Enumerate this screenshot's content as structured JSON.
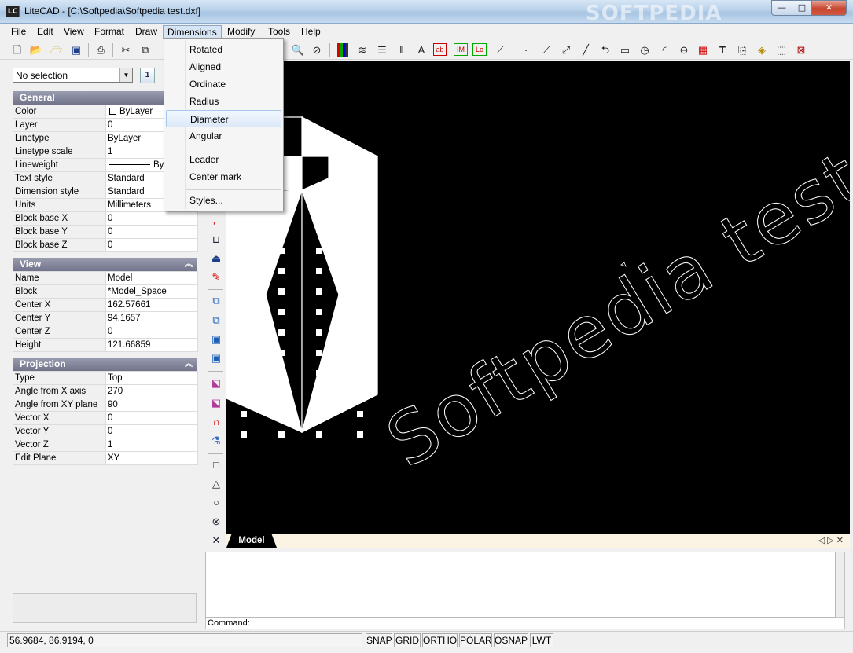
{
  "window": {
    "title": "LiteCAD - [C:\\Softpedia\\Softpedia test.dxf]",
    "watermark": "SOFTPEDIA",
    "controls": {
      "minimize": "—",
      "maximize": "□",
      "close": "✕"
    }
  },
  "menubar": [
    "File",
    "Edit",
    "View",
    "Format",
    "Draw",
    "Dimensions",
    "Modify",
    "Tools",
    "Help"
  ],
  "dimensions_menu": {
    "items": [
      "Rotated",
      "Aligned",
      "Ordinate",
      "Radius",
      "Diameter",
      "Angular",
      "Leader",
      "Center mark",
      "Styles..."
    ],
    "highlighted": "Diameter"
  },
  "left_panel": {
    "selection": "No selection",
    "selection_button": "1",
    "general": {
      "title": "General",
      "rows": [
        [
          "Color",
          "ByLayer"
        ],
        [
          "Layer",
          "0"
        ],
        [
          "Linetype",
          "ByLayer"
        ],
        [
          "Linetype scale",
          "1"
        ],
        [
          "Lineweight",
          "By"
        ],
        [
          "Text style",
          "Standard"
        ],
        [
          "Dimension style",
          "Standard"
        ],
        [
          "Units",
          "Millimeters"
        ],
        [
          "Block base X",
          "0"
        ],
        [
          "Block base Y",
          "0"
        ],
        [
          "Block base Z",
          "0"
        ]
      ]
    },
    "view": {
      "title": "View",
      "rows": [
        [
          "Name",
          "Model"
        ],
        [
          "Block",
          "*Model_Space"
        ],
        [
          "Center X",
          "162.57661"
        ],
        [
          "Center Y",
          "94.1657"
        ],
        [
          "Center Z",
          "0"
        ],
        [
          "Height",
          "121.66859"
        ]
      ]
    },
    "projection": {
      "title": "Projection",
      "rows": [
        [
          "Type",
          "Top"
        ],
        [
          "Angle from X axis",
          "270"
        ],
        [
          "Angle from XY plane",
          "90"
        ],
        [
          "Vector X",
          "0"
        ],
        [
          "Vector Y",
          "0"
        ],
        [
          "Vector Z",
          "1"
        ],
        [
          "Edit Plane",
          "XY"
        ]
      ]
    }
  },
  "canvas": {
    "drawing_text": "Softpedia test",
    "background": "#000000",
    "foreground": "#ffffff"
  },
  "tabs": {
    "model": "Model",
    "nav": "◁ ▷ ✕"
  },
  "command": {
    "label": "Command:"
  },
  "status": {
    "coords": "56.9684,  86.9194,  0",
    "buttons": [
      "SNAP",
      "GRID",
      "ORTHO",
      "POLAR",
      "OSNAP",
      "LWT"
    ]
  }
}
